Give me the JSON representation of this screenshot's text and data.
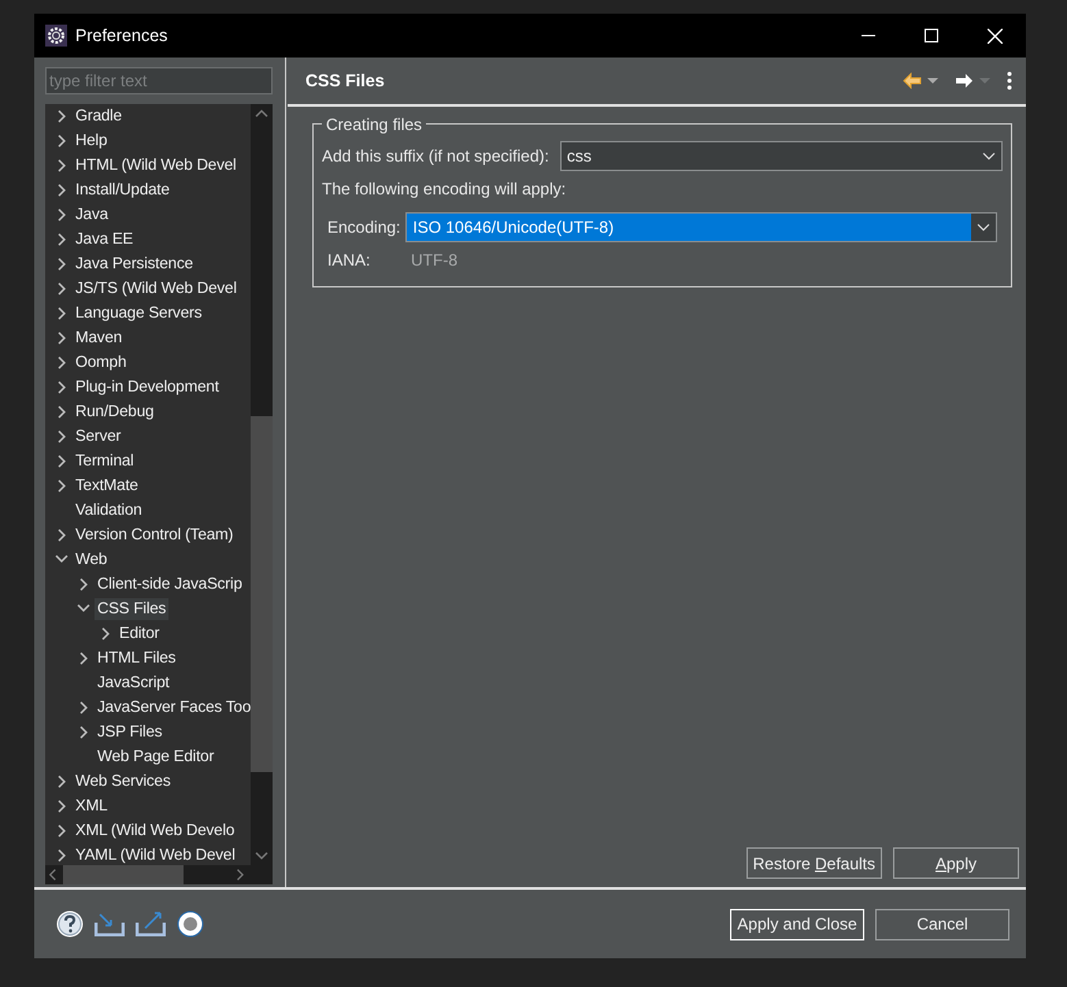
{
  "window": {
    "title": "Preferences"
  },
  "filter": {
    "placeholder": "type filter text"
  },
  "tree": [
    {
      "label": "Gradle",
      "expanded": false,
      "selected": false
    },
    {
      "label": "Help",
      "expanded": false,
      "selected": false
    },
    {
      "label": "HTML (Wild Web Devel",
      "expanded": false,
      "selected": false
    },
    {
      "label": "Install/Update",
      "expanded": false,
      "selected": false
    },
    {
      "label": "Java",
      "expanded": false,
      "selected": false
    },
    {
      "label": "Java EE",
      "expanded": false,
      "selected": false
    },
    {
      "label": "Java Persistence",
      "expanded": false,
      "selected": false
    },
    {
      "label": "JS/TS (Wild Web Devel",
      "expanded": false,
      "selected": false
    },
    {
      "label": "Language Servers",
      "expanded": false,
      "selected": false
    },
    {
      "label": "Maven",
      "expanded": false,
      "selected": false
    },
    {
      "label": "Oomph",
      "expanded": false,
      "selected": false
    },
    {
      "label": "Plug-in Development",
      "expanded": false,
      "selected": false
    },
    {
      "label": "Run/Debug",
      "expanded": false,
      "selected": false
    },
    {
      "label": "Server",
      "expanded": false,
      "selected": false
    },
    {
      "label": "Terminal",
      "expanded": false,
      "selected": false
    },
    {
      "label": "TextMate",
      "expanded": false,
      "selected": false
    },
    {
      "label": "Validation",
      "selected": false
    },
    {
      "label": "Version Control (Team)",
      "expanded": false,
      "selected": false
    },
    {
      "label": "Web",
      "expanded": true,
      "selected": false,
      "children": [
        {
          "label": "Client-side JavaScrip",
          "expanded": false,
          "selected": false
        },
        {
          "label": "CSS Files",
          "expanded": true,
          "selected": true,
          "children": [
            {
              "label": "Editor",
              "expanded": false,
              "selected": false
            }
          ]
        },
        {
          "label": "HTML Files",
          "expanded": false,
          "selected": false
        },
        {
          "label": "JavaScript",
          "selected": false
        },
        {
          "label": "JavaServer Faces Too",
          "expanded": false,
          "selected": false
        },
        {
          "label": "JSP Files",
          "expanded": false,
          "selected": false
        },
        {
          "label": "Web Page Editor",
          "selected": false
        }
      ]
    },
    {
      "label": "Web Services",
      "expanded": false,
      "selected": false
    },
    {
      "label": "XML",
      "expanded": false,
      "selected": false
    },
    {
      "label": "XML (Wild Web Develo",
      "expanded": false,
      "selected": false
    },
    {
      "label": "YAML (Wild Web Devel",
      "expanded": false,
      "selected": false
    }
  ],
  "page": {
    "title": "CSS Files",
    "group": {
      "title": "Creating files",
      "suffix_label": "Add this suffix (if not specified):",
      "suffix_value": "css",
      "encoding_note": "The following encoding will apply:",
      "encoding_label": "Encoding:",
      "encoding_value": "ISO 10646/Unicode(UTF-8)",
      "encoding_highlighted": true,
      "iana_label": "IANA:",
      "iana_value": "UTF-8"
    },
    "buttons": [
      {
        "label": "Restore Defaults",
        "mnemonic_underlined": true
      },
      {
        "label": "Apply",
        "mnemonic_underlined": true
      }
    ]
  },
  "dialog_buttons": [
    {
      "label": "Apply and Close",
      "default": true
    },
    {
      "label": "Cancel",
      "default": false
    }
  ]
}
